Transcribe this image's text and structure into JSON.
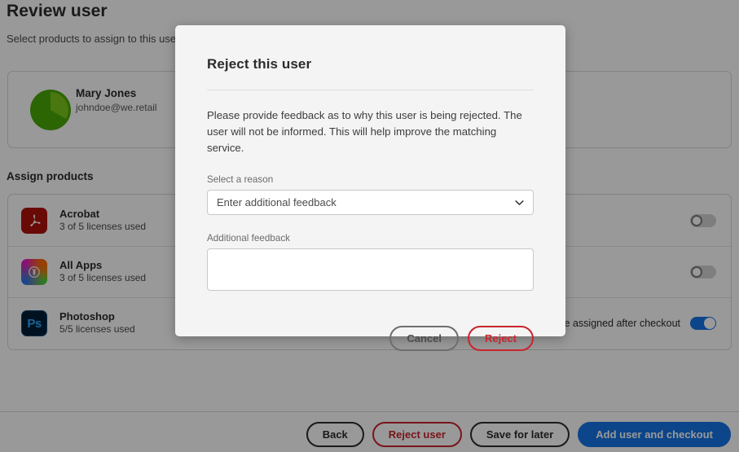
{
  "page": {
    "title": "Review user",
    "subtitle": "Select products to assign to this user",
    "section_label": "Assign products"
  },
  "user_card": {
    "name": "Mary Jones",
    "email": "johndoe@we.retail",
    "avatar_color": "#4aa808"
  },
  "products": [
    {
      "icon": "acrobat-icon",
      "name": "Acrobat",
      "licenses": "3 of 5 licenses used",
      "note": "",
      "toggle_on": false
    },
    {
      "icon": "creative-cloud-all-apps-icon",
      "name": "All Apps",
      "licenses": "3 of 5 licenses used",
      "note": "",
      "toggle_on": false
    },
    {
      "icon": "photoshop-icon",
      "name": "Photoshop",
      "icon_glyph": "Ps",
      "licenses": "5/5 licenses used",
      "note": "ill be assigned after checkout",
      "toggle_on": true
    }
  ],
  "footer": {
    "back_label": "Back",
    "reject_user_label": "Reject user",
    "save_for_later_label": "Save for later",
    "add_user_checkout_label": "Add user and checkout",
    "cta_color": "#1473e6",
    "danger_color": "#c9252d"
  },
  "modal": {
    "title": "Reject this user",
    "body": "Please provide feedback as to why this user is being rejected. The user will not be informed. This will help improve the matching service.",
    "reason": {
      "label": "Select a reason",
      "value": "Enter additional feedback",
      "chevron": "chevron-down-icon"
    },
    "feedback": {
      "label": "Additional feedback",
      "value": "",
      "placeholder": ""
    },
    "cancel_label": "Cancel",
    "reject_label": "Reject"
  }
}
